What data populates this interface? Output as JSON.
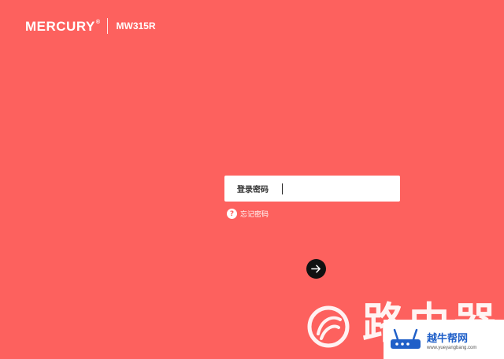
{
  "header": {
    "brand": "MERCURY",
    "trademark": "®",
    "model": "MW315R"
  },
  "login": {
    "password_label": "登录密码",
    "password_value": "",
    "forgot_icon": "?",
    "forgot_text": "忘记密码",
    "submit_icon": "arrow-right-icon"
  },
  "watermark": {
    "text": "路由器",
    "badge_title": "越牛帮网",
    "badge_url": "www.yueyangbang.com"
  },
  "colors": {
    "background": "#fd615e",
    "input_bg": "#ffffff",
    "submit_bg": "#111111",
    "badge_title": "#1f5fc8"
  }
}
